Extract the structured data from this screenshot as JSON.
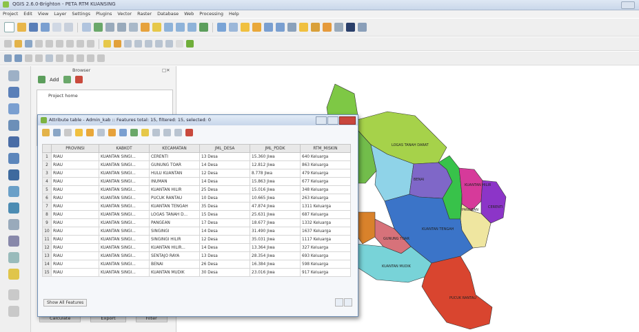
{
  "window": {
    "title": "QGIS 2.6.0-Brighton - PETA RTM KUANSING",
    "menu": [
      "Project",
      "Edit",
      "View",
      "Layer",
      "Settings",
      "Plugins",
      "Vector",
      "Raster",
      "Database",
      "Web",
      "Processing",
      "Help"
    ]
  },
  "browser_panel": {
    "title": "Browser",
    "add_label": "Add",
    "tree_root": "Project home",
    "bottom_buttons": [
      "Calculate",
      "Export",
      "Filter"
    ]
  },
  "attribute_table": {
    "title": "Attribute table - Admin_kab :: Features total: 15, filtered: 15, selected: 0",
    "columns": [
      "PROVINSI",
      "KABKOT",
      "KECAMATAN",
      "JML_DESA",
      "JML_PDDK",
      "RTM_MISKIN"
    ],
    "rows": [
      [
        "RIAU",
        "KUANTAN SINGI...",
        "CERENTI",
        "13 Desa",
        "15.360 Jiwa",
        "640 Keluarga"
      ],
      [
        "RIAU",
        "KUANTAN SINGI...",
        "GUNUNG TOAR",
        "14 Desa",
        "12.812 Jiwa",
        "863 Keluarga"
      ],
      [
        "RIAU",
        "KUANTAN SINGI...",
        "HULU KUANTAN",
        "12 Desa",
        "8.778 Jiwa",
        "479 Keluarga"
      ],
      [
        "RIAU",
        "KUANTAN SINGI...",
        "INUMAN",
        "14 Desa",
        "15.863 Jiwa",
        "677 Keluarga"
      ],
      [
        "RIAU",
        "KUANTAN SINGI...",
        "KUANTAN HILIR",
        "25 Desa",
        "15.016 Jiwa",
        "348 Keluarga"
      ],
      [
        "RIAU",
        "KUANTAN SINGI...",
        "PUCUK RANTAU",
        "10 Desa",
        "10.665 Jiwa",
        "263 Keluarga"
      ],
      [
        "RIAU",
        "KUANTAN SINGI...",
        "KUANTAN TENGAH",
        "35 Desa",
        "47.874 Jiwa",
        "1311 Keluarga"
      ],
      [
        "RIAU",
        "KUANTAN SINGI...",
        "LOGAS TANAH D...",
        "15 Desa",
        "25.631 Jiwa",
        "687 Keluarga"
      ],
      [
        "RIAU",
        "KUANTAN SINGI...",
        "PANGEAN",
        "17 Desa",
        "18.677 Jiwa",
        "1332 Keluarga"
      ],
      [
        "RIAU",
        "KUANTAN SINGI...",
        "SINGINGI",
        "14 Desa",
        "31.490 Jiwa",
        "1637 Keluarga"
      ],
      [
        "RIAU",
        "KUANTAN SINGI...",
        "SINGINGI HILIR",
        "12 Desa",
        "35.031 Jiwa",
        "1117 Keluarga"
      ],
      [
        "RIAU",
        "KUANTAN SINGI...",
        "KUANTAN HILIR...",
        "14 Desa",
        "13.364 Jiwa",
        "327 Keluarga"
      ],
      [
        "RIAU",
        "KUANTAN SINGI...",
        "SENTAJO RAYA",
        "13 Desa",
        "28.354 Jiwa",
        "693 Keluarga"
      ],
      [
        "RIAU",
        "KUANTAN SINGI...",
        "BENAI",
        "26 Desa",
        "16.384 Jiwa",
        "598 Keluarga"
      ],
      [
        "RIAU",
        "KUANTAN SINGI...",
        "KUANTAN MUDIK",
        "30 Desa",
        "23.016 Jiwa",
        "917 Keluarga"
      ]
    ],
    "show_all_label": "Show All Features"
  },
  "map_labels": {
    "logas": "LOGAS TANAH DARAT",
    "benai": "BENAI",
    "kuantan_hilir": "KUANTAN HILIR",
    "pangean": "PANGEAN",
    "cerenti": "CERENTI",
    "kuantan_tengah": "KUANTAN TENGAH",
    "gunung_toar": "GUNUNG TOAR",
    "kuantan_mudik": "KUANTAN MUDIK",
    "pucuk_rantau": "PUCUK RANTAU"
  },
  "colors": {
    "selection_red": "#c9463d",
    "toolbar_bg": "#efefef"
  }
}
